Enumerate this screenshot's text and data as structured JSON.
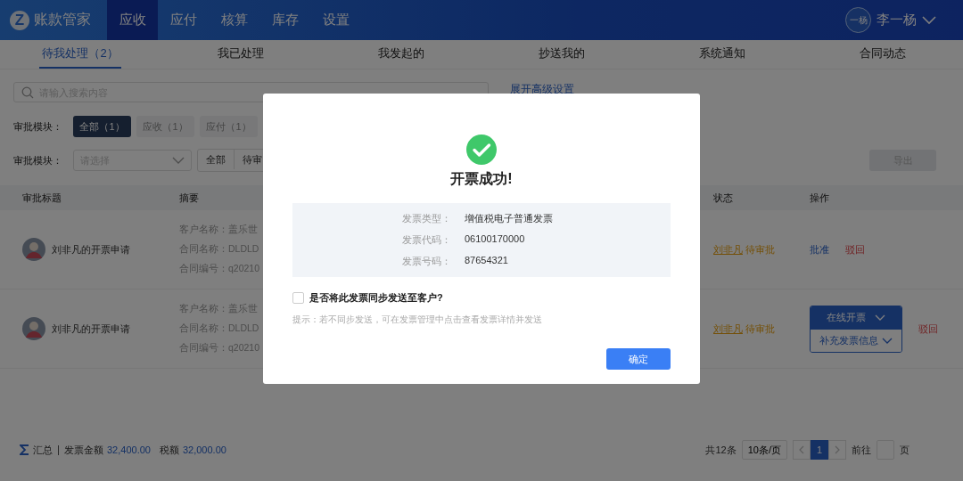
{
  "app": {
    "logo": "Z",
    "name": "账款管家"
  },
  "nav": [
    {
      "label": "应收",
      "selected": true
    },
    {
      "label": "应付",
      "selected": false
    },
    {
      "label": "核算",
      "selected": false
    },
    {
      "label": "库存",
      "selected": false
    },
    {
      "label": "设置",
      "selected": false
    }
  ],
  "user": {
    "avatar_text": "一杨",
    "name": "李一杨"
  },
  "tabs": [
    {
      "label": "待我处理（2）",
      "selected": true
    },
    {
      "label": "我已处理",
      "selected": false
    },
    {
      "label": "我发起的",
      "selected": false
    },
    {
      "label": "抄送我的",
      "selected": false
    },
    {
      "label": "系统通知",
      "selected": false
    },
    {
      "label": "合同动态",
      "selected": false
    }
  ],
  "search": {
    "placeholder": "请输入搜索内容"
  },
  "advanced_link": "展开高级设置",
  "module_filter": {
    "label": "审批模块：",
    "options": [
      {
        "label": "全部（1）",
        "selected": true
      },
      {
        "label": "应收（1）",
        "selected": false
      },
      {
        "label": "应付（1）",
        "selected": false
      }
    ]
  },
  "status_filter": {
    "label": "审批模块：",
    "select_placeholder": "请选择",
    "segments": [
      "全部",
      "待审"
    ]
  },
  "export_button": {
    "label": "导出",
    "disabled": true
  },
  "table": {
    "columns": [
      "审批标题",
      "摘要",
      "状态",
      "操作"
    ],
    "rows": [
      {
        "title": "刘非凡的开票申请",
        "summary": [
          "客户名称：盖乐世",
          "合同名称：DLDLD",
          "合同编号：q20210"
        ],
        "status_user": "刘非凡",
        "status": "待审批",
        "actions": [
          {
            "kind": "approve",
            "label": "批准"
          },
          {
            "kind": "reject",
            "label": "驳回"
          }
        ]
      },
      {
        "title": "刘非凡的开票申请",
        "summary": [
          "客户名称：盖乐世",
          "合同名称：DLDLD",
          "合同编号：q20210"
        ],
        "status_user": "刘非凡",
        "status": "待审批",
        "actions": [
          {
            "kind": "split",
            "label": "在线开票",
            "sub_label": "补充发票信息"
          },
          {
            "kind": "reject",
            "label": "驳回"
          }
        ]
      }
    ]
  },
  "footer": {
    "summary_label": "汇总",
    "amount_label": "发票金额",
    "amount": "32,400.00",
    "tax_label": "税额",
    "tax": "32,000.00"
  },
  "pagination": {
    "total": "共12条",
    "page_size": "10条/页",
    "pages": [
      {
        "label": "1",
        "selected": true
      }
    ],
    "goto_label": "前往",
    "goto_suffix": "页"
  },
  "dialog": {
    "title": "开票成功!",
    "fields": [
      {
        "label": "发票类型：",
        "value": "增值税电子普通发票"
      },
      {
        "label": "发票代码：",
        "value": "06100170000"
      },
      {
        "label": "发票号码：",
        "value": "87654321"
      }
    ],
    "checkbox": {
      "label": "是否将此发票同步发送至客户?",
      "checked": false
    },
    "hint": "提示：若不同步发送，可在发票管理中点击查看发票详情并发送",
    "confirm": "确定"
  }
}
